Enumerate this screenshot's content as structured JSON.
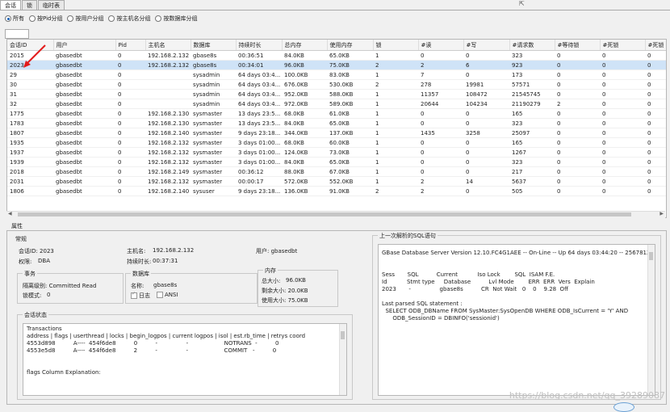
{
  "tabs": [
    "会话",
    "锁",
    "临时表"
  ],
  "filters": [
    {
      "label": "所有",
      "checked": true
    },
    {
      "label": "按Pid分组",
      "checked": false
    },
    {
      "label": "按用户分组",
      "checked": false
    },
    {
      "label": "按主机名分组",
      "checked": false
    },
    {
      "label": "按数据库分组",
      "checked": false
    }
  ],
  "grid": {
    "columns": [
      "会话ID",
      "用户",
      "Pid",
      "主机名",
      "数据库",
      "持续时长",
      "总内存",
      "使用内存",
      "锁",
      "#读",
      "#写",
      "#请求数",
      "#等待锁",
      "#死锁",
      "#死锁"
    ],
    "rows": [
      [
        "2015",
        "gbasedbt",
        "0",
        "192.168.2.132",
        "gbase8s",
        "00:36:51",
        "84.0KB",
        "65.0KB",
        "1",
        "0",
        "0",
        "323",
        "0",
        "0",
        "0"
      ],
      [
        "2023",
        "gbasedbt",
        "0",
        "192.168.2.132",
        "gbase8s",
        "00:34:01",
        "96.0KB",
        "75.0KB",
        "2",
        "2",
        "6",
        "923",
        "0",
        "0",
        "0"
      ],
      [
        "29",
        "gbasedbt",
        "0",
        "",
        "sysadmin",
        "64 days 03:4...",
        "100.0KB",
        "83.0KB",
        "1",
        "7",
        "0",
        "173",
        "0",
        "0",
        "0"
      ],
      [
        "30",
        "gbasedbt",
        "0",
        "",
        "sysadmin",
        "64 days 03:4...",
        "676.0KB",
        "530.0KB",
        "2",
        "278",
        "19981",
        "57571",
        "0",
        "0",
        "0"
      ],
      [
        "31",
        "gbasedbt",
        "0",
        "",
        "sysadmin",
        "64 days 03:4...",
        "952.0KB",
        "588.0KB",
        "1",
        "11357",
        "108472",
        "21545745",
        "0",
        "0",
        "0"
      ],
      [
        "32",
        "gbasedbt",
        "0",
        "",
        "sysadmin",
        "64 days 03:4...",
        "972.0KB",
        "589.0KB",
        "1",
        "20644",
        "104234",
        "21190279",
        "2",
        "0",
        "0"
      ],
      [
        "1775",
        "gbasedbt",
        "0",
        "192.168.2.130",
        "sysmaster",
        "13 days 23:5...",
        "68.0KB",
        "61.0KB",
        "1",
        "0",
        "0",
        "165",
        "0",
        "0",
        "0"
      ],
      [
        "1783",
        "gbasedbt",
        "0",
        "192.168.2.130",
        "sysmaster",
        "13 days 23:5...",
        "84.0KB",
        "65.0KB",
        "1",
        "0",
        "0",
        "323",
        "0",
        "0",
        "0"
      ],
      [
        "1807",
        "gbasedbt",
        "0",
        "192.168.2.140",
        "sysmaster",
        "9 days 23:18...",
        "344.0KB",
        "137.0KB",
        "1",
        "1435",
        "3258",
        "25097",
        "0",
        "0",
        "0"
      ],
      [
        "1935",
        "gbasedbt",
        "0",
        "192.168.2.132",
        "sysmaster",
        "3 days 01:00...",
        "68.0KB",
        "60.0KB",
        "1",
        "0",
        "0",
        "165",
        "0",
        "0",
        "0"
      ],
      [
        "1937",
        "gbasedbt",
        "0",
        "192.168.2.132",
        "sysmaster",
        "3 days 01:00...",
        "124.0KB",
        "73.0KB",
        "1",
        "0",
        "0",
        "1267",
        "0",
        "0",
        "0"
      ],
      [
        "1939",
        "gbasedbt",
        "0",
        "192.168.2.132",
        "sysmaster",
        "3 days 01:00...",
        "84.0KB",
        "65.0KB",
        "1",
        "0",
        "0",
        "323",
        "0",
        "0",
        "0"
      ],
      [
        "2018",
        "gbasedbt",
        "0",
        "192.168.2.149",
        "sysmaster",
        "00:36:12",
        "88.0KB",
        "67.0KB",
        "1",
        "0",
        "0",
        "217",
        "0",
        "0",
        "0"
      ],
      [
        "2031",
        "gbasedbt",
        "0",
        "192.168.2.132",
        "sysmaster",
        "00:00:17",
        "572.0KB",
        "552.0KB",
        "1",
        "2",
        "14",
        "5637",
        "0",
        "0",
        "0"
      ],
      [
        "1806",
        "gbasedbt",
        "0",
        "192.168.2.140",
        "sysuser",
        "9 days 23:18...",
        "136.0KB",
        "91.0KB",
        "2",
        "2",
        "0",
        "505",
        "0",
        "0",
        "0"
      ]
    ]
  },
  "props": {
    "title": "属性",
    "general_title": "常规",
    "session_id": "会话ID: 2023",
    "permission_label": "权限:",
    "permission_value": "DBA",
    "hostname_label": "主机名:",
    "hostname_value": "192.168.2.132",
    "duration_label": "持续时长:",
    "duration_value": "00:37:31",
    "user": "用户: gbasedbt",
    "tx_title": "事务",
    "isolation": "隔离级别: Committed Read",
    "lock_mode": "锁模式:",
    "lock_mode_value": "0",
    "db_title": "数据库",
    "db_name_label": "名称:",
    "db_name_value": "gbase8s",
    "log_label": "日志",
    "ansi_label": "ANSI",
    "mem_title": "内存",
    "mem_total": "总大小:",
    "mem_total_value": "96.0KB",
    "mem_free": "剩余大小: 20.0KB",
    "mem_used": "使用大小: 75.0KB",
    "state_title": "会话状态",
    "state_text": "Transactions\naddress | flags | userthread | locks | begin_logpos | current logpos | isol | est.rb_time | retrys coord\n4553d898          A----  454f6de8          0          -                -                    NOTRANS  -          0\n4553e5d8          A----  454f6de8          2          -                -                    COMMIT   -          0\n\n\nflags Column Explanation:",
    "sql_title": "上一次解析的SQL语句",
    "sql_text": "GBase Database Server Version 12.10.FC4G1AEE -- On-Line -- Up 64 days 03:44:20 -- 2567812 Kby\n\n\nSess       SQL          Current           Iso Lock        SQL  ISAM F.E.\nId           Stmt type     Database          Lvl Mode        ERR  ERR  Vers  Explain\n2023       -                gbase8s          CR  Not Wait   0    0    9.28  Off\n\nLast parsed SQL statement :\n  SELECT ODB_DBName FROM SysMaster:SysOpenDB WHERE ODB_IsCurrent = 'Y' AND\n      ODB_SessionID = DBINFO('sessionid')"
  },
  "watermark": "https://blog.csdn.net/qq_39289087"
}
